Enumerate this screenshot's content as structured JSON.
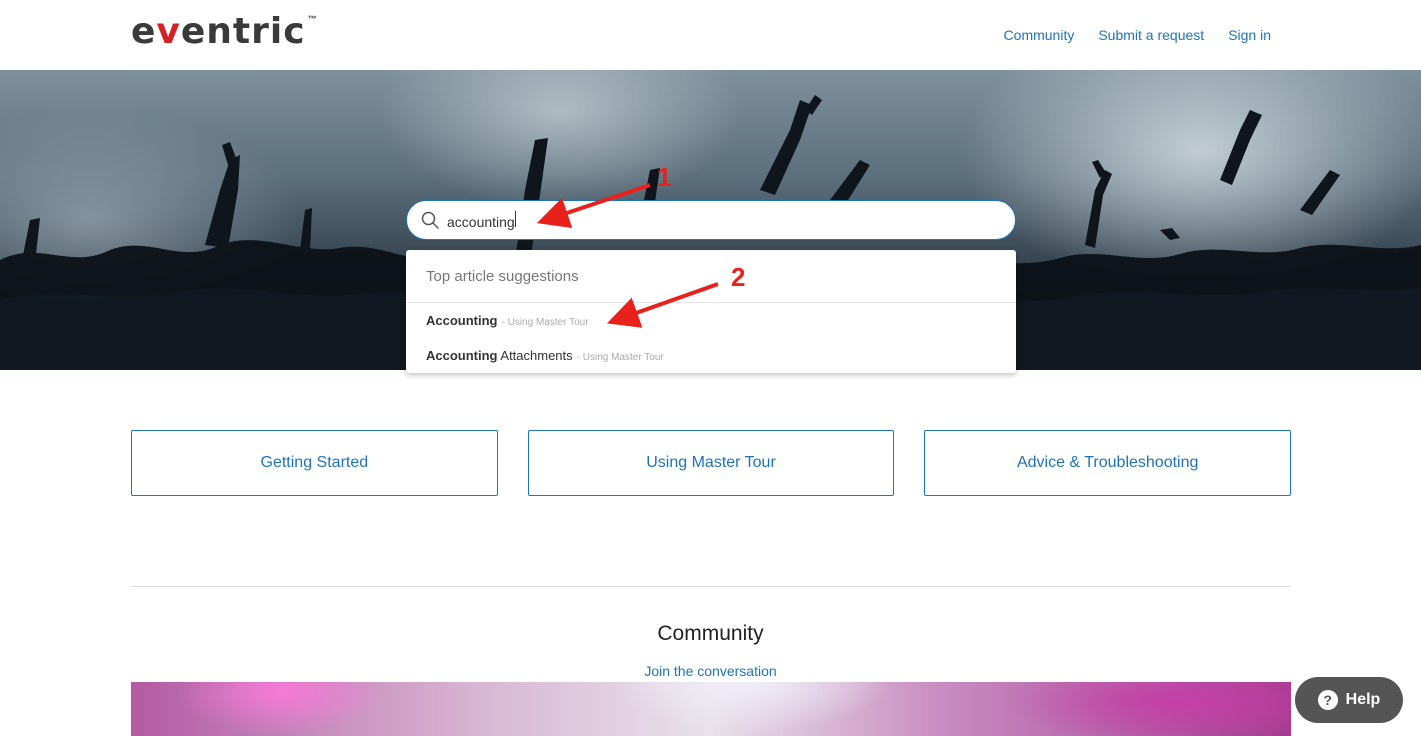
{
  "header": {
    "logo_text": "eventric",
    "logo_tm": "™",
    "nav": [
      {
        "label": "Community"
      },
      {
        "label": "Submit a request"
      },
      {
        "label": "Sign in"
      }
    ]
  },
  "search": {
    "value": "accounting"
  },
  "suggestions": {
    "heading": "Top article suggestions",
    "items": [
      {
        "match": "Accounting",
        "rest": "",
        "meta": "- Using Master Tour"
      },
      {
        "match": "Accounting",
        "rest": " Attachments",
        "meta": "- Using Master Tour"
      }
    ]
  },
  "annotations": {
    "marker_1": "1",
    "marker_2": "2",
    "color": "#e8211d"
  },
  "categories": [
    {
      "label": "Getting Started"
    },
    {
      "label": "Using Master Tour"
    },
    {
      "label": "Advice & Troubleshooting"
    }
  ],
  "community": {
    "title": "Community",
    "link": "Join the conversation"
  },
  "help": {
    "label": "Help",
    "icon": "?"
  },
  "colors": {
    "link": "#1f73b7",
    "brand_red": "#d71f26"
  }
}
